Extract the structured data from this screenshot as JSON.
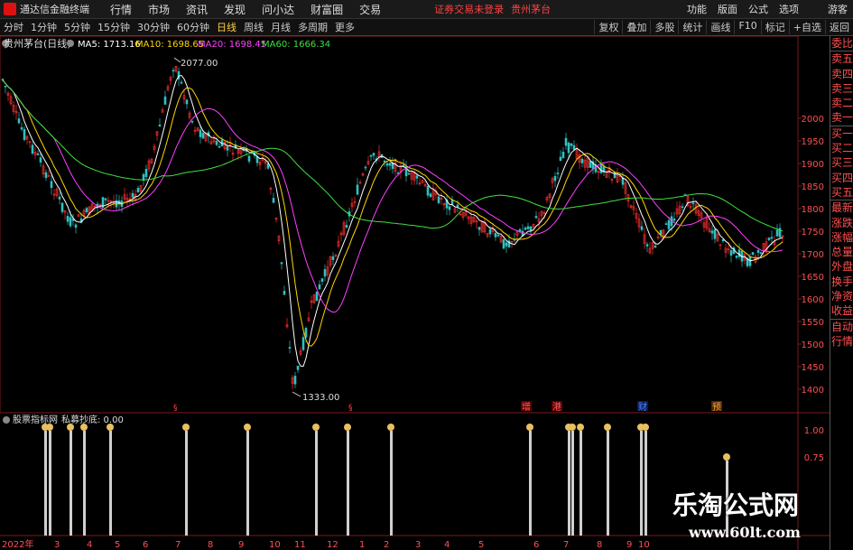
{
  "menubar": {
    "app_title": "通达信金融终端",
    "items": [
      "行情",
      "市场",
      "资讯",
      "发现",
      "问小达",
      "财富圈",
      "交易"
    ],
    "warning": "证券交易未登录",
    "stock": "贵州茅台",
    "right": [
      "功能",
      "版面",
      "公式",
      "选项"
    ],
    "guest": "游客"
  },
  "toolbar": {
    "timeframes": [
      "分时",
      "1分钟",
      "5分钟",
      "15分钟",
      "30分钟",
      "60分钟",
      "日线",
      "周线",
      "月线",
      "多周期",
      "更多"
    ],
    "active_index": 6,
    "buttons": [
      "复权",
      "叠加",
      "多股",
      "统计",
      "画线",
      "F10",
      "标记",
      "+自选",
      "返回"
    ]
  },
  "main_chart": {
    "name": "贵州茅台(日线)",
    "ma": [
      {
        "label": "MA5: 1713.16",
        "color": "#ffffff"
      },
      {
        "label": "MA10: 1698.65",
        "color": "#ffd700"
      },
      {
        "label": "MA20: 1698.45",
        "color": "#ff40ff"
      },
      {
        "label": "MA60: 1666.34",
        "color": "#40e040"
      }
    ],
    "high_label": "2077.00",
    "low_label": "1333.00",
    "y_ticks": [
      "2000",
      "1950",
      "1900",
      "1850",
      "1800",
      "1750",
      "1700",
      "1650",
      "1600",
      "1550",
      "1500",
      "1450",
      "1400"
    ],
    "event_markers": [
      {
        "text": "增",
        "color": "#ff6060"
      },
      {
        "text": "港",
        "color": "#ff6060"
      },
      {
        "text": "财",
        "color": "#6080ff"
      },
      {
        "text": "预",
        "color": "#ffa040"
      }
    ]
  },
  "sub_chart": {
    "name": "股票指标网",
    "indicator": "私募抄底: 0.00",
    "y_ticks": [
      "1.00",
      "0.75"
    ],
    "signal_count": 20
  },
  "x_axis": {
    "labels": [
      "2022年",
      "3",
      "4",
      "5",
      "6",
      "7",
      "8",
      "9",
      "10",
      "11",
      "12",
      "1",
      "2",
      "3",
      "4",
      "5",
      "6",
      "7",
      "8",
      "9",
      "10"
    ]
  },
  "sidepanel": {
    "items": [
      "委比",
      "卖五",
      "卖四",
      "卖三",
      "卖二",
      "卖一",
      "买一",
      "买二",
      "买三",
      "买四",
      "买五",
      "最新",
      "涨跌",
      "涨幅",
      "总量",
      "外盘",
      "换手",
      "净资",
      "收益",
      "自动",
      "行情"
    ]
  },
  "watermark": {
    "title": "乐淘公式网",
    "url": "www.60lt.com"
  }
}
